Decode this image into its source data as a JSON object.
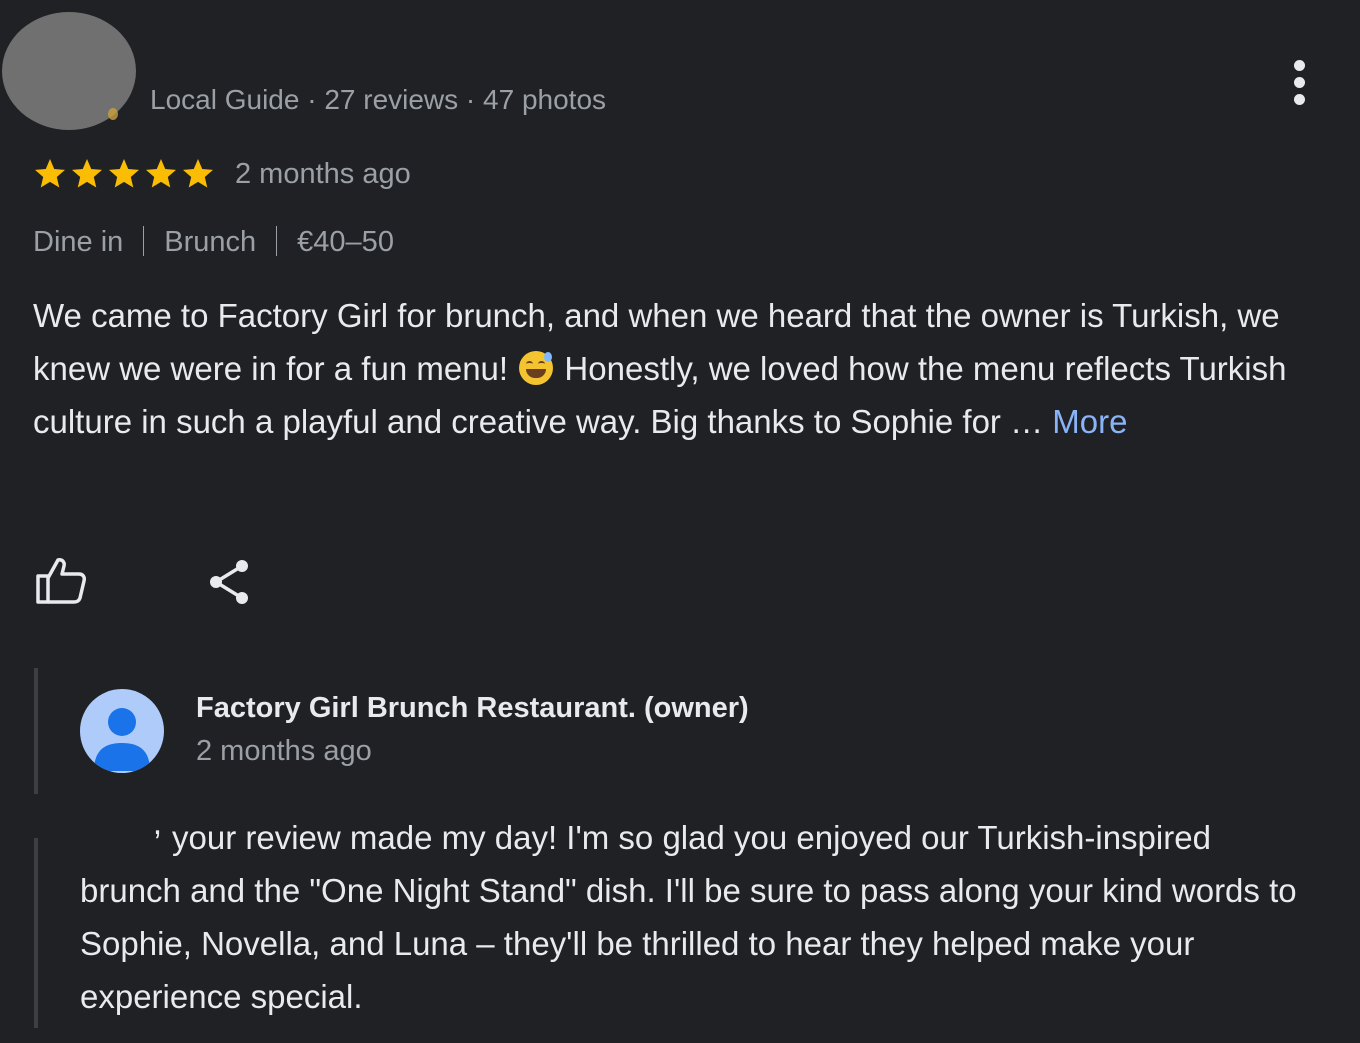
{
  "reviewer": {
    "meta": "Local Guide · 27 reviews · 47 photos"
  },
  "review": {
    "rating": 5,
    "rating_max": 5,
    "date": "2 months ago",
    "attributes": [
      "Dine in",
      "Brunch",
      "€40–50"
    ],
    "text_part1": "We came to Factory Girl for brunch, and when we heard that the owner is Turkish, we knew we were in for a fun menu!",
    "emoji": "grinning-face-with-sweat",
    "text_part2": "Honestly, we loved how the menu reflects Turkish culture in such a playful and creative way. Big thanks to Sophie for …",
    "more_label": "More"
  },
  "actions": {
    "like_icon": "thumbs-up-icon",
    "share_icon": "share-icon"
  },
  "owner_response": {
    "name": "Factory Girl Brunch Restaurant. (owner)",
    "date": "2 months ago",
    "text_prefix": ",",
    "text": "your review made my day! I'm so glad you enjoyed our Turkish-inspired brunch and the \"One Night Stand\" dish. I'll be sure to pass along your kind words to Sophie, Novella, and Luna – they'll be thrilled to hear they helped make your experience special."
  },
  "colors": {
    "background": "#202124",
    "text": "#e8eaed",
    "secondary_text": "#9aa0a6",
    "star": "#fbbc04",
    "link": "#8ab4f8",
    "owner_avatar": "#aecbfa",
    "owner_avatar_figure": "#1a73e8"
  }
}
